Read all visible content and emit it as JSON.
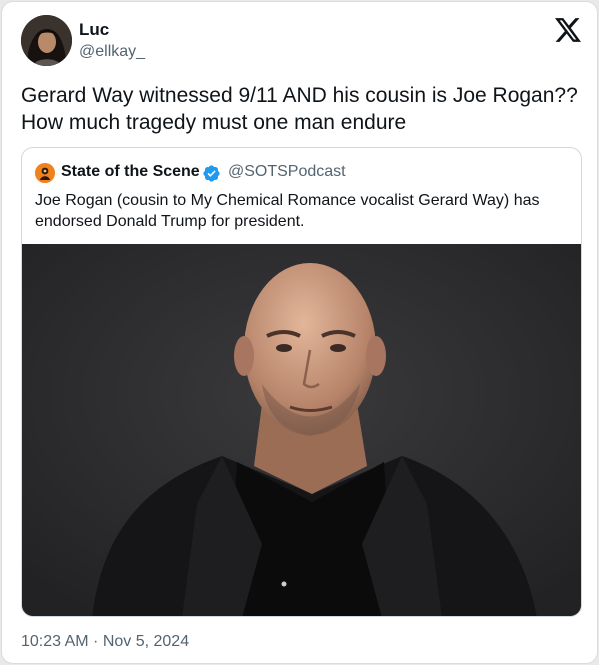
{
  "tweet": {
    "author": {
      "display_name": "Luc",
      "handle": "@ellkay_",
      "avatar_icon": "profile-photo"
    },
    "text": "Gerard Way witnessed 9/11 AND his cousin is Joe Rogan?? How much tragedy must one man endure",
    "timestamp": "10:23 AM · Nov 5, 2024",
    "platform_icon": "x-logo-icon"
  },
  "quoted_tweet": {
    "author": {
      "display_name": "State of the Scene",
      "handle": "@SOTSPodcast",
      "verified": true,
      "verified_color": "#1d9bf0",
      "avatar_icon": "sots-logo-icon",
      "avatar_color": "#f0821e"
    },
    "text": "Joe Rogan (cousin to My Chemical Romance vocalist Gerard Way) has endorsed Donald Trump for president.",
    "media": {
      "type": "photo",
      "subject": "portrait"
    }
  },
  "colors": {
    "text_primary": "#0f1419",
    "text_secondary": "#536471",
    "border": "#cfd9de",
    "photo_background": "#2c2c2e"
  }
}
